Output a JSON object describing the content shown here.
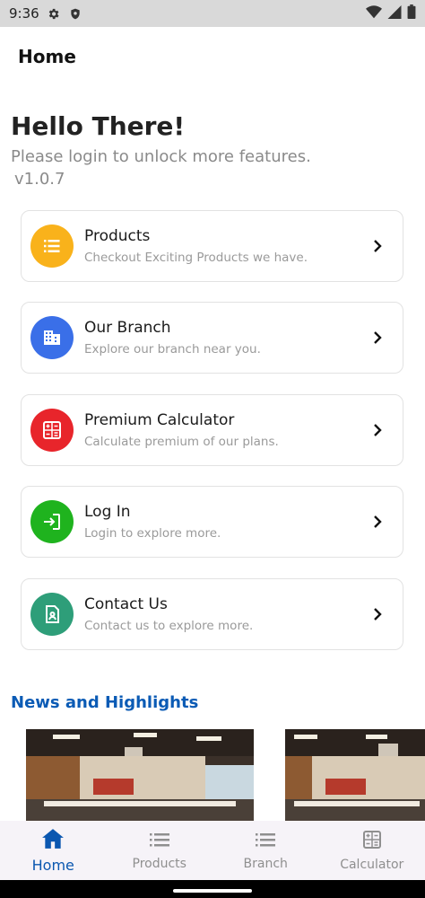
{
  "status": {
    "time": "9:36"
  },
  "appbar": {
    "title": "Home"
  },
  "header": {
    "greeting": "Hello There!",
    "subtitle": "Please login to unlock more features.",
    "version": "v1.0.7"
  },
  "menu": [
    {
      "title": "Products",
      "subtitle": "Checkout Exciting Products we have.",
      "icon": "list-icon",
      "color": "#F9B21B"
    },
    {
      "title": "Our Branch",
      "subtitle": "Explore our branch near you.",
      "icon": "building-icon",
      "color": "#3A6FE8"
    },
    {
      "title": "Premium Calculator",
      "subtitle": "Calculate premium of our plans.",
      "icon": "calculator-icon",
      "color": "#E8252B"
    },
    {
      "title": "Log In",
      "subtitle": "Login to explore more.",
      "icon": "login-icon",
      "color": "#1FB31E"
    },
    {
      "title": "Contact Us",
      "subtitle": "Contact us to explore more.",
      "icon": "contact-icon",
      "color": "#2E9E79"
    }
  ],
  "news": {
    "title": "News and Highlights"
  },
  "bottom_nav": [
    {
      "label": "Home",
      "icon": "home-icon",
      "active": true
    },
    {
      "label": "Products",
      "icon": "list-icon",
      "active": false
    },
    {
      "label": "Branch",
      "icon": "list-icon",
      "active": false
    },
    {
      "label": "Calculator",
      "icon": "calculator-icon",
      "active": false
    }
  ],
  "colors": {
    "accent": "#0B57B0",
    "news_title": "#0B5BB5"
  }
}
